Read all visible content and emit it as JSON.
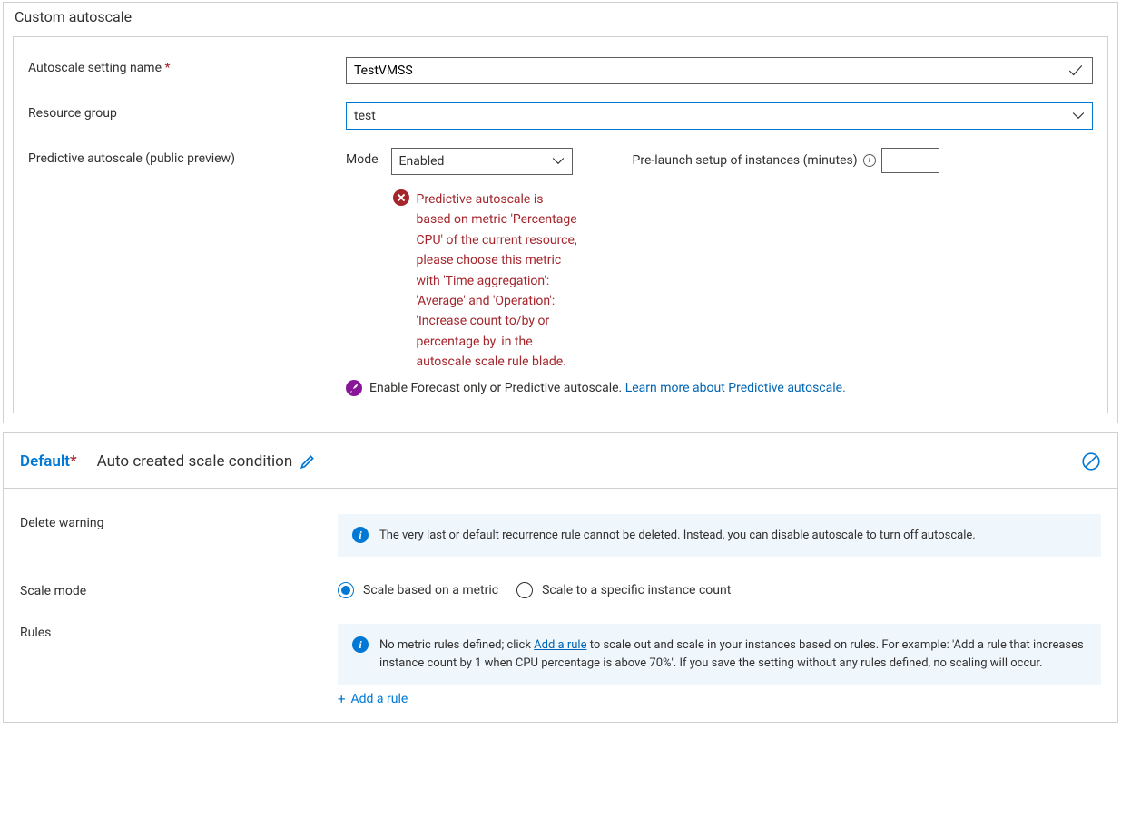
{
  "panel": {
    "title": "Custom autoscale",
    "setting_name_label": "Autoscale setting name",
    "setting_name_value": "TestVMSS",
    "resource_group_label": "Resource group",
    "resource_group_value": "test",
    "predictive_label": "Predictive autoscale (public preview)",
    "mode_label": "Mode",
    "mode_value": "Enabled",
    "prelaunch_label": "Pre-launch setup of instances (minutes)",
    "prelaunch_value": "",
    "error_text": "Predictive autoscale is based on metric 'Percentage CPU' of the current resource, please choose this metric with 'Time aggregation': 'Average' and 'Operation': 'Increase count to/by or percentage by' in the autoscale scale rule blade.",
    "helper_text": "Enable Forecast only or Predictive autoscale. ",
    "helper_link": "Learn more about Predictive autoscale."
  },
  "condition": {
    "default_label": "Default",
    "title": "Auto created scale condition",
    "delete_warning_label": "Delete warning",
    "delete_warning_text": "The very last or default recurrence rule cannot be deleted. Instead, you can disable autoscale to turn off autoscale.",
    "scale_mode_label": "Scale mode",
    "scale_mode_options": [
      {
        "label": "Scale based on a metric",
        "selected": true
      },
      {
        "label": "Scale to a specific instance count",
        "selected": false
      }
    ],
    "rules_label": "Rules",
    "rules_info_pre": "No metric rules defined; click ",
    "rules_info_link": "Add a rule",
    "rules_info_post": " to scale out and scale in your instances based on rules. For example: 'Add a rule that increases instance count by 1 when CPU percentage is above 70%'. If you save the setting without any rules defined, no scaling will occur.",
    "add_rule_label": "Add a rule"
  }
}
